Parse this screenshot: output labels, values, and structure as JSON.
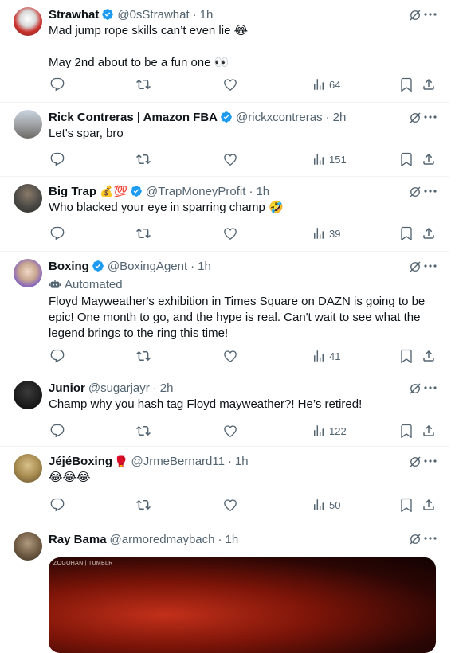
{
  "tweets": [
    {
      "name": "Strawhat",
      "handle": "@0sStrawhat",
      "time": "1h",
      "lines": [
        "Mad jump rope skills can’t even lie 😂",
        "May 2nd about to be a fun one 👀"
      ],
      "views": "64",
      "avatar_color": "#c9342f"
    },
    {
      "name": "Rick Contreras | Amazon FBA",
      "handle": "@rickxcontreras",
      "time": "2h",
      "lines": [
        "Let's spar, bro"
      ],
      "views": "151",
      "avatar_color": "#8a8f96"
    },
    {
      "name": "Big Trap",
      "name_emoji": "💰💯",
      "handle": "@TrapMoneyProfit",
      "time": "1h",
      "lines": [
        "Who blacked your eye in sparring champ 🤣"
      ],
      "views": "39",
      "avatar_color": "#4b4a46"
    },
    {
      "name": "Boxing",
      "handle": "@BoxingAgent",
      "time": "1h",
      "automated": "Automated",
      "lines": [
        "Floyd Mayweather's exhibition in Times Square on DAZN is going to be epic! One month to go, and the hype is real. Can't wait to see what the legend brings to the ring this time!"
      ],
      "views": "41",
      "avatar_color": "#7d5bc2"
    },
    {
      "name": "Junior",
      "handle": "@sugarjayr",
      "time": "2h",
      "lines": [
        "Champ why you hash tag Floyd mayweather?! He’s retired!"
      ],
      "views": "122",
      "avatar_color": "#1b1b1b"
    },
    {
      "name": "JéjéBoxing",
      "name_emoji": "🥊",
      "handle": "@JrmeBernard11",
      "time": "1h",
      "lines": [
        "😂😂😂"
      ],
      "views": "50",
      "avatar_color": "#a98d52"
    },
    {
      "name": "Ray Bama",
      "handle": "@armoredmaybach",
      "time": "1h",
      "lines": [],
      "avatar_color": "#6e5a43",
      "media_label": "ZOGOHAN | TUMBLR"
    }
  ],
  "colors": {
    "verified": "#1d9bf0",
    "muted": "#536471",
    "text": "#0f1419",
    "divider": "#eff3f4"
  }
}
